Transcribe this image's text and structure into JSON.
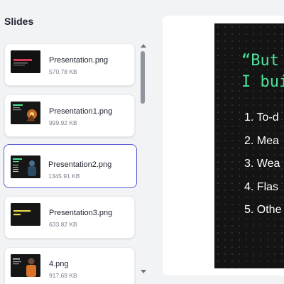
{
  "panel_title": "Slides",
  "slides": [
    {
      "name": "Presentation.png",
      "size": "570.78 KB",
      "thumb": "thumb-red-title"
    },
    {
      "name": "Presentation1.png",
      "size": "999.92 KB",
      "thumb": "thumb-rocket"
    },
    {
      "name": "Presentation2.png",
      "size": "1345.91 KB",
      "thumb": "thumb-person-dark",
      "selected": true
    },
    {
      "name": "Presentation3.png",
      "size": "633.82 KB",
      "thumb": "thumb-yellow-text"
    },
    {
      "name": "4.png",
      "size": "917.69 KB",
      "thumb": "thumb-person-orange"
    }
  ],
  "preview": {
    "quote_lines": [
      "“But",
      "I bui"
    ],
    "list_items": [
      "1. To-d",
      "2. Mea",
      "3. Wea",
      "4. Flas",
      "5. Othe"
    ]
  },
  "colors": {
    "accent": "#5b5fd6",
    "preview_bg": "#141414",
    "quote_green": "#4ee39a"
  }
}
